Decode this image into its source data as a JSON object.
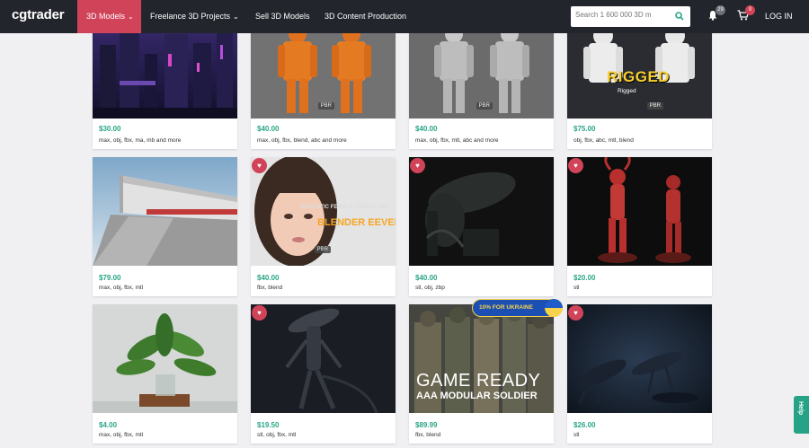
{
  "brand": "cgtrader",
  "nav": {
    "models": "3D Models",
    "freelance": "Freelance 3D Projects",
    "sell": "Sell 3D Models",
    "production": "3D Content Production",
    "search_placeholder": "Search 1 600 000 3D m",
    "notifications_count": "29",
    "cart_count": "0",
    "login": "LOG IN"
  },
  "ukraine_banner": "10% FOR UKRAINE",
  "help_label": "Help",
  "cards": [
    {
      "price": "$30.00",
      "formats": "max, obj, fbx, ma, mb and more"
    },
    {
      "price": "$40.00",
      "formats": "max, obj, fbx, blend, abc and more",
      "badge": "PBR"
    },
    {
      "price": "$40.00",
      "formats": "max, obj, fbx, mtl, abc and more",
      "badge": "PBR"
    },
    {
      "price": "$75.00",
      "formats": "obj, fbx, abc, mtl, blend",
      "overlay": "RIGGED",
      "overlay_sub": "Rigged",
      "badge": "PBR"
    },
    {
      "price": "$79.00",
      "formats": "max, obj, fbx, mtl"
    },
    {
      "price": "$40.00",
      "formats": "fbx, blend",
      "overlay": "REALISTIC FEMALE CHARACTER",
      "overlay_sub": "BLENDER EEVEE",
      "badge": "PBR"
    },
    {
      "price": "$40.00",
      "formats": "stl, obj, zbp"
    },
    {
      "price": "$20.00",
      "formats": "stl"
    },
    {
      "price": "$4.00",
      "formats": "max, obj, fbx, mtl"
    },
    {
      "price": "$19.50",
      "formats": "stl, obj, fbx, mtl"
    },
    {
      "price": "$89.99",
      "formats": "fbx, blend",
      "overlay": "GAME READY",
      "overlay_sub": "AAA MODULAR SOLDIER"
    },
    {
      "price": "$26.00",
      "formats": "stl"
    }
  ]
}
